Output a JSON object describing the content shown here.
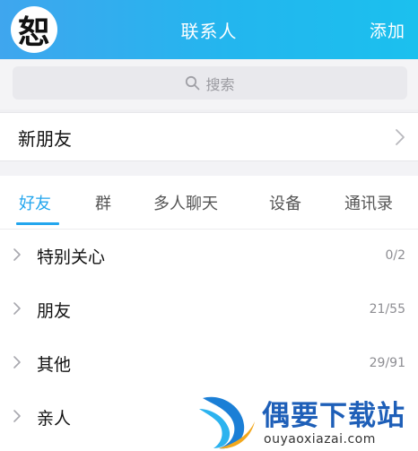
{
  "header": {
    "avatar_char": "恕",
    "title": "联系人",
    "add_label": "添加"
  },
  "search": {
    "placeholder": "搜索"
  },
  "new_friends": {
    "label": "新朋友"
  },
  "tabs": [
    {
      "label": "好友",
      "active": true
    },
    {
      "label": "群",
      "active": false
    },
    {
      "label": "多人聊天",
      "active": false
    },
    {
      "label": "设备",
      "active": false
    },
    {
      "label": "通讯录",
      "active": false
    }
  ],
  "groups": [
    {
      "name": "特别关心",
      "count": "0/2"
    },
    {
      "name": "朋友",
      "count": "21/55"
    },
    {
      "name": "其他",
      "count": "29/91"
    },
    {
      "name": "亲人",
      "count": ""
    }
  ],
  "watermark": {
    "title": "偶要下载站",
    "url": "ouyaoxiazai.com"
  },
  "colors": {
    "header_start": "#3fa6ee",
    "header_end": "#1bc0ee",
    "accent": "#23a6ee"
  },
  "icons": {
    "search": "search-icon",
    "chevron_right": "chevron-right-icon",
    "watermark_logo": "watermark-logo"
  }
}
